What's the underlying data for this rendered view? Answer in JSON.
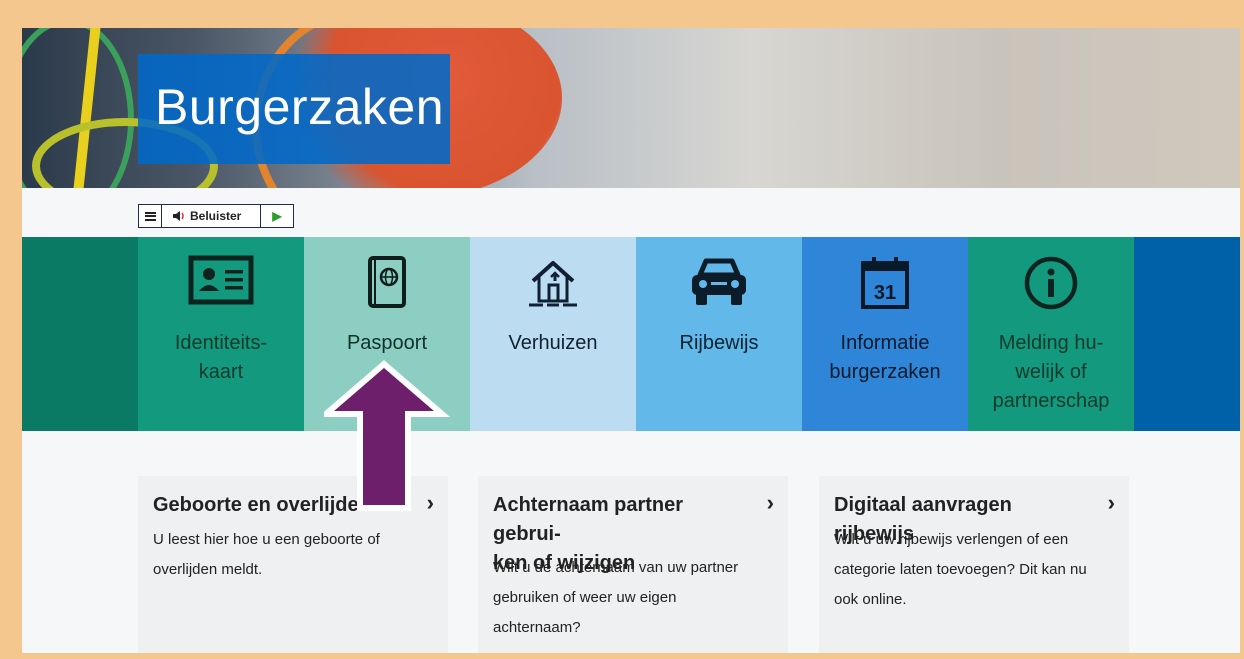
{
  "header": {
    "title": "Burgerzaken"
  },
  "listen_bar": {
    "label": "Beluister",
    "menu_icon": "menu-icon",
    "speaker_icon": "speaker-icon",
    "play_icon": "play-icon"
  },
  "tiles": [
    {
      "label": "Identiteits-\nkaart",
      "icon": "id-card-icon",
      "bg": "#139a7e",
      "fg": "#0b3a2c"
    },
    {
      "label": "Paspoort",
      "icon": "passport-icon",
      "bg": "#8ccfc2",
      "fg": "#10302a"
    },
    {
      "label": "Verhuizen",
      "icon": "house-move-icon",
      "bg": "#bcdcf2",
      "fg": "#10202e"
    },
    {
      "label": "Rijbewijs",
      "icon": "car-icon",
      "bg": "#62b8e8",
      "fg": "#0a2232"
    },
    {
      "label": "Informatie\nburgerzaken",
      "icon": "calendar-icon",
      "bg": "#2f86d8",
      "fg": "#081a2a",
      "calendar_day": "31"
    },
    {
      "label": "Melding hu-\nwelijk of\npartnerschap",
      "icon": "info-icon",
      "bg": "#139a7e",
      "fg": "#0b3a2c"
    }
  ],
  "cards": [
    {
      "title": "Geboorte en overlijden",
      "description": "U leest hier hoe u een geboorte of\noverlijden meldt."
    },
    {
      "title": "Achternaam partner gebrui-\nken of wijzigen",
      "description": "Wilt u de achternaam van uw partner\ngebruiken of weer uw eigen\nachternaam?"
    },
    {
      "title": "Digitaal aanvragen rijbewijs",
      "description": "Wilt u uw rijbewijs verlengen of een\ncategorie laten toevoegen? Dit kan nu\nook online."
    }
  ],
  "annotation": {
    "arrow_color": "#6e1f6b",
    "arrow_icon": "pointer-arrow-icon"
  },
  "colors": {
    "frame": "#f4c78e",
    "title_box": "#0069c8"
  }
}
